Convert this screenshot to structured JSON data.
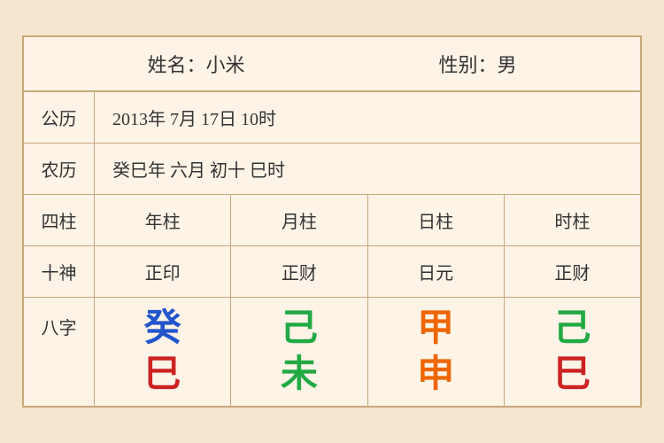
{
  "header": {
    "name_label": "姓名：小米",
    "gender_label": "性别：男"
  },
  "solar": {
    "label": "公历",
    "value": "2013年 7月 17日 10时"
  },
  "lunar": {
    "label": "农历",
    "value": "癸巳年 六月 初十 巳时"
  },
  "grid": {
    "sizhu_label": "四柱",
    "shishen_label": "十神",
    "bazi_label": "八字",
    "columns": [
      {
        "sizhu": "年柱",
        "shishen": "正印",
        "tian": "癸",
        "di": "巳",
        "tian_color": "blue",
        "di_color": "red"
      },
      {
        "sizhu": "月柱",
        "shishen": "正财",
        "tian": "己",
        "di": "未",
        "tian_color": "green",
        "di_color": "green"
      },
      {
        "sizhu": "日柱",
        "shishen": "日元",
        "tian": "甲",
        "di": "申",
        "tian_color": "orange",
        "di_color": "orange"
      },
      {
        "sizhu": "时柱",
        "shishen": "正财",
        "tian": "己",
        "di": "巳",
        "tian_color": "green2",
        "di_color": "red2"
      }
    ]
  }
}
